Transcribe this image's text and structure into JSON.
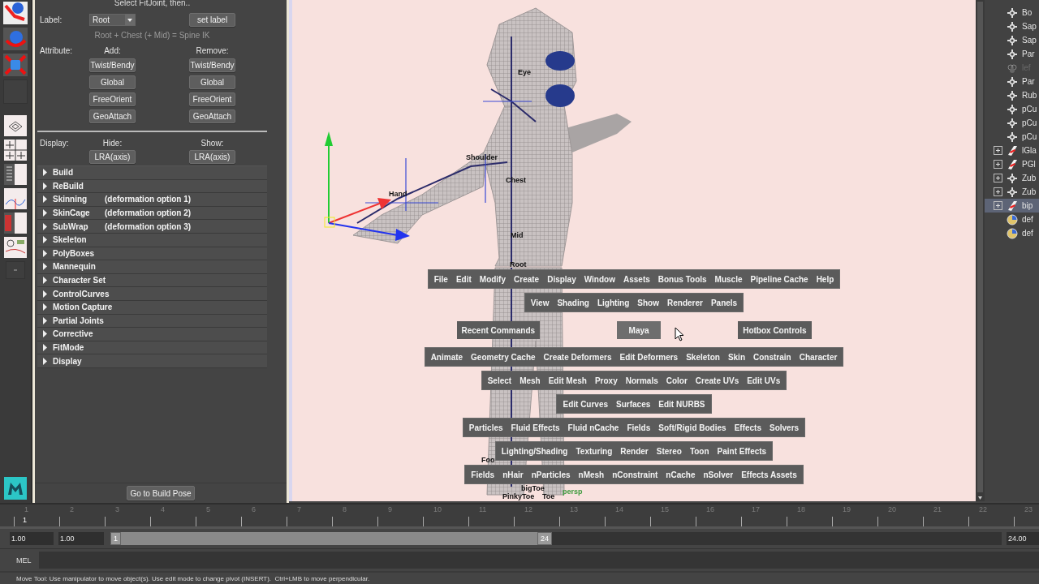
{
  "panel": {
    "header": "Select FitJoint, then..",
    "label_row": {
      "label": "Label:",
      "value": "Root",
      "button": "set label"
    },
    "hint": "Root + Chest (+ Mid) = Spine IK",
    "attribute": {
      "label": "Attribute:",
      "add_heading": "Add:",
      "remove_heading": "Remove:",
      "add_buttons": [
        "Twist/Bendy",
        "Global",
        "FreeOrient",
        "GeoAttach"
      ],
      "remove_buttons": [
        "Twist/Bendy",
        "Global",
        "FreeOrient",
        "GeoAttach"
      ]
    },
    "display": {
      "label": "Display:",
      "hide_heading": "Hide:",
      "show_heading": "Show:",
      "hide_button": "LRA(axis)",
      "show_button": "LRA(axis)"
    },
    "sections": [
      {
        "title": "Build",
        "expanded": false
      },
      {
        "title": "ReBuild",
        "expanded": false
      },
      {
        "title": "Skinning",
        "note": "(deformation option 1)",
        "expanded": false
      },
      {
        "title": "SkinCage",
        "note": "(deformation option 2)",
        "expanded": false
      },
      {
        "title": "SubWrap",
        "note": "(deformation option 3)",
        "expanded": false
      },
      {
        "title": "Skeleton",
        "expanded": false
      },
      {
        "title": "PolyBoxes",
        "expanded": false
      },
      {
        "title": "Mannequin",
        "expanded": false
      },
      {
        "title": "Character Set",
        "expanded": false
      },
      {
        "title": "ControlCurves",
        "expanded": false
      },
      {
        "title": "Motion Capture",
        "expanded": false
      },
      {
        "title": "Partial Joints",
        "expanded": false
      },
      {
        "title": "Corrective",
        "expanded": false
      },
      {
        "title": "FitMode",
        "expanded": false
      },
      {
        "title": "Display",
        "expanded": false
      }
    ],
    "footer_button": "Go to Build Pose"
  },
  "viewport": {
    "joint_labels": [
      "Eye",
      "Shoulder",
      "Chest",
      "Hand",
      "Mid",
      "Root",
      "Foo",
      "bigToe",
      "PinkyToe",
      "Toe"
    ],
    "camera_label": "persp",
    "hotbox": {
      "rows": [
        {
          "kind": "bar",
          "items": [
            "File",
            "Edit",
            "Modify",
            "Create",
            "Display",
            "Window",
            "Assets",
            "Bonus Tools",
            "Muscle",
            "Pipeline Cache",
            "Help"
          ]
        },
        {
          "kind": "bar",
          "items": [
            "View",
            "Shading",
            "Lighting",
            "Show",
            "Renderer",
            "Panels"
          ]
        },
        {
          "kind": "split",
          "items": [
            "Recent Commands",
            "Maya",
            "Hotbox Controls"
          ]
        },
        {
          "kind": "bar",
          "items": [
            "Animate",
            "Geometry Cache",
            "Create Deformers",
            "Edit Deformers",
            "Skeleton",
            "Skin",
            "Constrain",
            "Character"
          ]
        },
        {
          "kind": "bar",
          "items": [
            "Select",
            "Mesh",
            "Edit Mesh",
            "Proxy",
            "Normals",
            "Color",
            "Create UVs",
            "Edit UVs"
          ]
        },
        {
          "kind": "bar",
          "items": [
            "Edit Curves",
            "Surfaces",
            "Edit NURBS"
          ]
        },
        {
          "kind": "bar",
          "items": [
            "Particles",
            "Fluid Effects",
            "Fluid nCache",
            "Fields",
            "Soft/Rigid Bodies",
            "Effects",
            "Solvers"
          ]
        },
        {
          "kind": "bar",
          "items": [
            "Lighting/Shading",
            "Texturing",
            "Render",
            "Stereo",
            "Toon",
            "Paint Effects"
          ]
        },
        {
          "kind": "bar",
          "items": [
            "Fields",
            "nHair",
            "nParticles",
            "nMesh",
            "nConstraint",
            "nCache",
            "nSolver",
            "Effects Assets"
          ]
        }
      ]
    }
  },
  "outliner": {
    "items": [
      {
        "text": "Bo",
        "kind": "transform",
        "expandable": false,
        "hidden": false,
        "selected": false
      },
      {
        "text": "Sap",
        "kind": "transform",
        "expandable": false,
        "hidden": false,
        "selected": false
      },
      {
        "text": "Sap",
        "kind": "transform",
        "expandable": false,
        "hidden": false,
        "selected": false
      },
      {
        "text": "Par",
        "kind": "transform",
        "expandable": false,
        "hidden": false,
        "selected": false
      },
      {
        "text": "lef",
        "kind": "group",
        "expandable": false,
        "hidden": true,
        "selected": false
      },
      {
        "text": "Par",
        "kind": "transform",
        "expandable": false,
        "hidden": false,
        "selected": false
      },
      {
        "text": "Rub",
        "kind": "transform",
        "expandable": false,
        "hidden": false,
        "selected": false
      },
      {
        "text": "pCu",
        "kind": "transform",
        "expandable": false,
        "hidden": false,
        "selected": false
      },
      {
        "text": "pCu",
        "kind": "transform",
        "expandable": false,
        "hidden": false,
        "selected": false
      },
      {
        "text": "pCu",
        "kind": "transform",
        "expandable": false,
        "hidden": false,
        "selected": false
      },
      {
        "text": "lGla",
        "kind": "joint",
        "expandable": true,
        "hidden": false,
        "selected": false
      },
      {
        "text": "PGl",
        "kind": "joint",
        "expandable": true,
        "hidden": false,
        "selected": false
      },
      {
        "text": "Zub",
        "kind": "transform",
        "expandable": true,
        "hidden": false,
        "selected": false
      },
      {
        "text": "Zub",
        "kind": "transform",
        "expandable": true,
        "hidden": false,
        "selected": false
      },
      {
        "text": "bip",
        "kind": "joint",
        "expandable": true,
        "hidden": false,
        "selected": true
      },
      {
        "text": "def",
        "kind": "set",
        "expandable": false,
        "hidden": false,
        "selected": false
      },
      {
        "text": "def",
        "kind": "set",
        "expandable": false,
        "hidden": false,
        "selected": false
      }
    ]
  },
  "timeline": {
    "ticks": [
      "1",
      "2",
      "3",
      "4",
      "5",
      "6",
      "7",
      "8",
      "9",
      "10",
      "11",
      "12",
      "13",
      "14",
      "15",
      "16",
      "17",
      "18",
      "19",
      "20",
      "21",
      "22",
      "23"
    ],
    "current_frame": "1"
  },
  "range": {
    "start": "1.00",
    "playback_start": "1.00",
    "range_start": "1",
    "range_end": "24",
    "playback_end": "24.00"
  },
  "command_line": {
    "label": "MEL"
  },
  "status": "Move Tool: Use manipulator to move object(s). Use edit mode to change pivot (INSERT).  Ctrl+LMB to move perpendicular."
}
